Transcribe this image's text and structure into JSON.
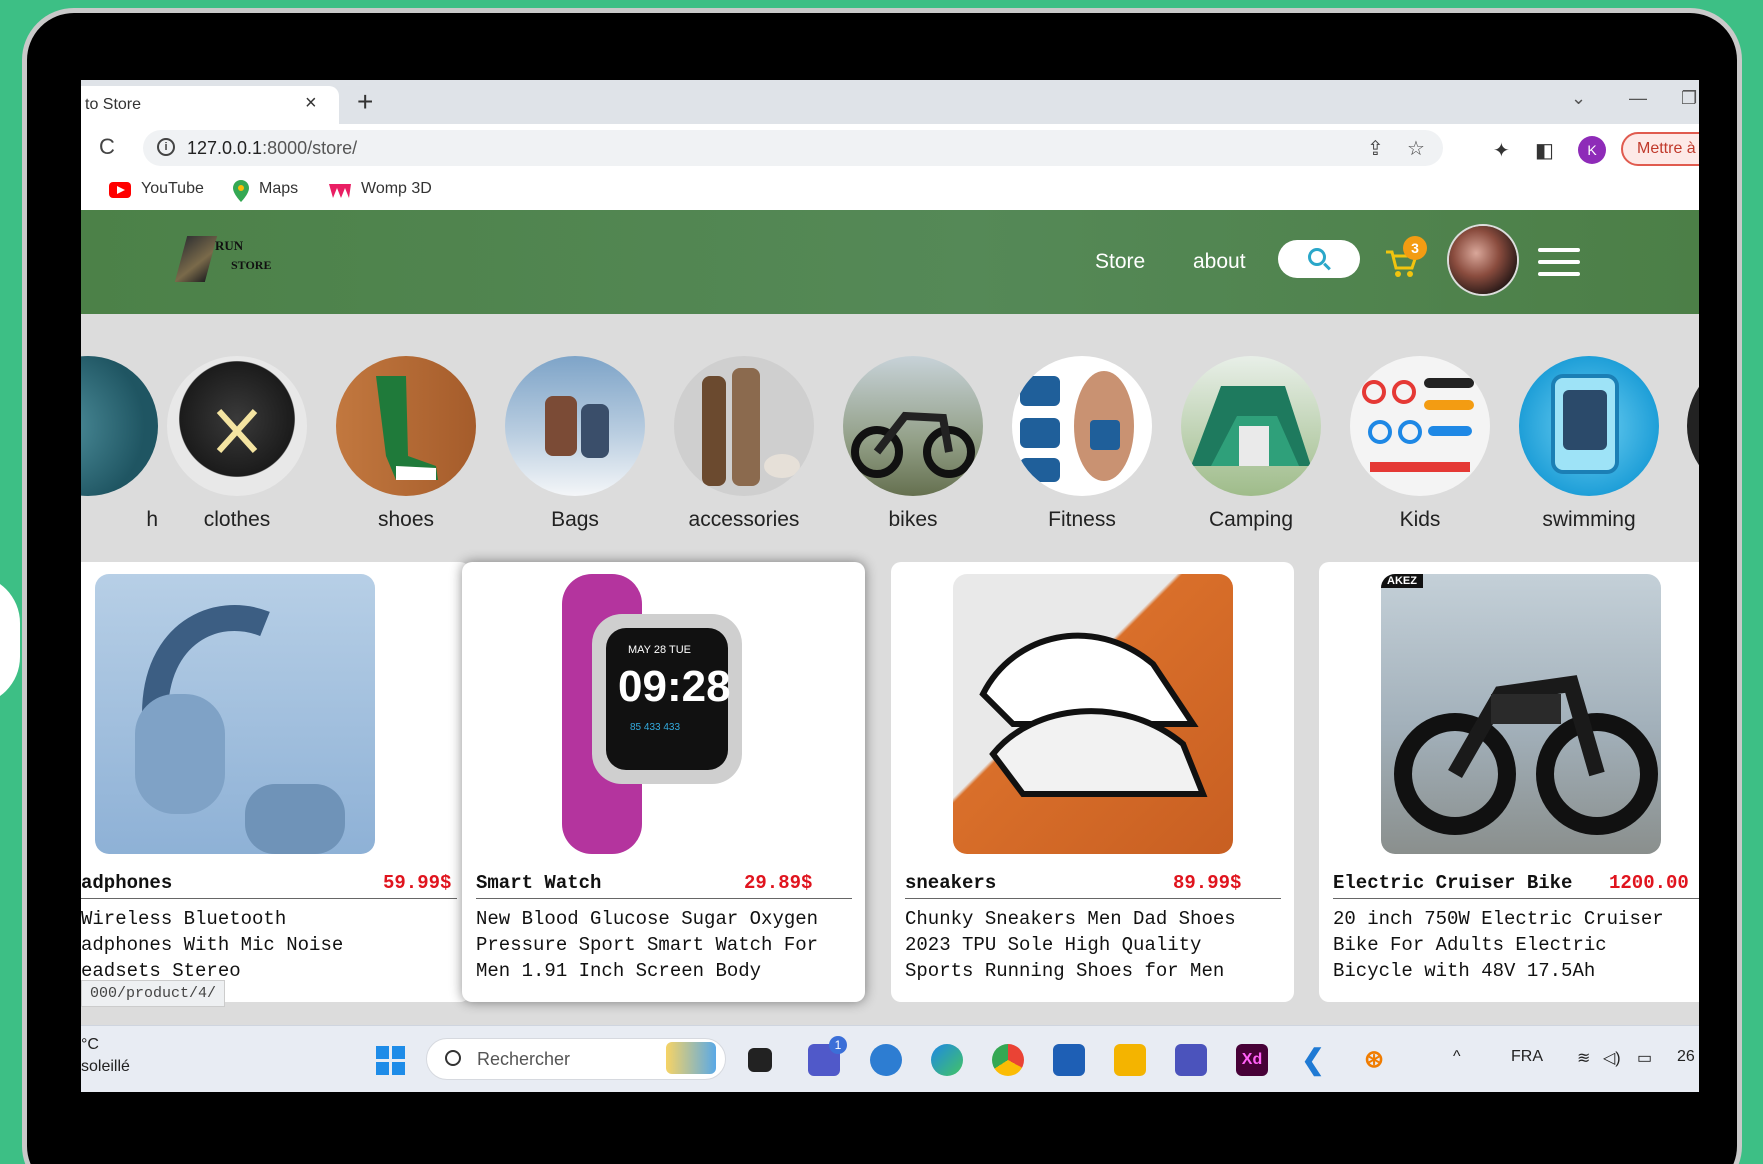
{
  "browser": {
    "tab_title": "to Store",
    "tab_close": "×",
    "new_tab": "+",
    "win_chevron": "⌄",
    "win_minimize": "—",
    "win_restore": "❐",
    "reload": "C",
    "url_host": "127.0.0.1",
    "url_path": ":8000/store/",
    "share_glyph": "⇪",
    "star_glyph": "☆",
    "puzzle_glyph": "✦",
    "panel_glyph": "◧",
    "profile_letter": "K",
    "update_label": "Mettre à",
    "bookmarks": [
      {
        "label": "YouTube",
        "color": "#ff0000"
      },
      {
        "label": "Maps",
        "color": "#34a853"
      },
      {
        "label": "Womp 3D",
        "color": "#e91e63"
      }
    ],
    "status_url": "000/product/4/"
  },
  "header": {
    "logo_run": "RUN",
    "logo_store": "STORE",
    "nav": [
      "Store",
      "about"
    ],
    "cart_count": "3"
  },
  "categories": [
    {
      "label": "h",
      "color": "#2b6d7a"
    },
    {
      "label": "clothes",
      "color": "#2a2a2a"
    },
    {
      "label": "shoes",
      "color": "#b86a3c"
    },
    {
      "label": "Bags",
      "color": "#8aa6c2"
    },
    {
      "label": "accessories",
      "color": "#8c6a4e"
    },
    {
      "label": "bikes",
      "color": "#5d6b52"
    },
    {
      "label": "Fitness",
      "color": "#2a5a8a"
    },
    {
      "label": "Camping",
      "color": "#2f8a6b"
    },
    {
      "label": "Kids",
      "color": "#f2f2f2"
    },
    {
      "label": "swimming",
      "color": "#2fa7d8"
    }
  ],
  "products": [
    {
      "name": "adphones",
      "price": "59.99$",
      "desc": [
        "Wireless Bluetooth",
        "adphones With Mic Noise",
        "eadsets Stereo"
      ],
      "img_color": "#a9c6e3"
    },
    {
      "name": "Smart Watch",
      "price": "29.89$",
      "desc": [
        "New Blood Glucose Sugar Oxygen",
        "Pressure Sport Smart Watch For",
        "Men 1.91 Inch Screen Body"
      ],
      "img_color": "#ffffff"
    },
    {
      "name": "sneakers",
      "price": "89.99$",
      "desc": [
        "Chunky Sneakers Men Dad Shoes",
        "2023 TPU Sole High Quality",
        "Sports Running Shoes for Men"
      ],
      "img_color": "#d96f2a"
    },
    {
      "name": "Electric Cruiser Bike",
      "price": "1200.00",
      "desc": [
        "20 inch 750W Electric Cruiser",
        "Bike For Adults Electric",
        "Bicycle with 48V 17.5Ah"
      ],
      "img_color": "#9fb2c0"
    }
  ],
  "watch_face": {
    "date": "MAY 28  TUE",
    "time": "09:28",
    "stats": "85 433  433"
  },
  "bike_brand": "AKEZ",
  "taskbar": {
    "weather_temp": "°C",
    "weather_text": "soleillé",
    "search_label": "Rechercher",
    "teams_badge": "1",
    "xd_label": "Xd",
    "language": "FRA",
    "chevron_up": "^",
    "time_partial": "26"
  }
}
